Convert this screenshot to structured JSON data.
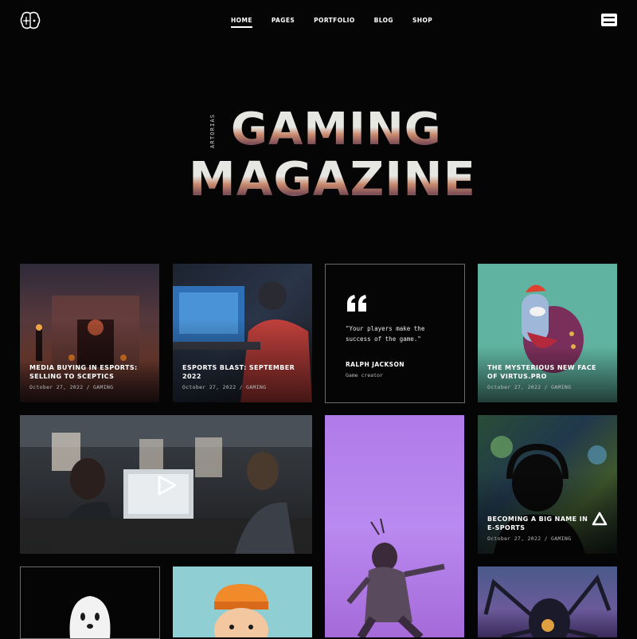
{
  "header": {
    "nav": [
      {
        "label": "HOME",
        "active": true
      },
      {
        "label": "PAGES",
        "active": false
      },
      {
        "label": "PORTFOLIO",
        "active": false
      },
      {
        "label": "BLOG",
        "active": false
      },
      {
        "label": "SHOP",
        "active": false
      }
    ]
  },
  "hero": {
    "side_label": "ARTORIAS",
    "title_line1": "GAMING",
    "title_line2": "MAGAZINE"
  },
  "cards": {
    "c1": {
      "title": "MEDIA BUYING IN ESPORTS: SELLING TO SCEPTICS",
      "meta": "October 27, 2022 / GAMING"
    },
    "c2": {
      "title": "ESPORTS BLAST: SEPTEMBER 2022",
      "meta": "October 27, 2022 / GAMING"
    },
    "c4": {
      "title": "THE MYSTERIOUS NEW FACE OF VIRTUS.PRO",
      "meta": "October 27, 2022 / GAMING"
    },
    "c7": {
      "title": "BECOMING A BIG NAME IN E-SPORTS",
      "meta": "October 27, 2022 / GAMING"
    }
  },
  "quote": {
    "text": "\"Your players make the success of the game.\"",
    "author": "RALPH JACKSON",
    "role": "Game creator"
  },
  "colors": {
    "background": "#050505",
    "text": "#ffffff",
    "meta": "#bdbdbd",
    "card_teal": "#5fb3a0",
    "card_purple": "#b77be8",
    "card_skyblue": "#8fcfd3"
  },
  "icons": [
    "brain-logo-icon",
    "menu-icon",
    "quote-icon",
    "play-icon"
  ]
}
